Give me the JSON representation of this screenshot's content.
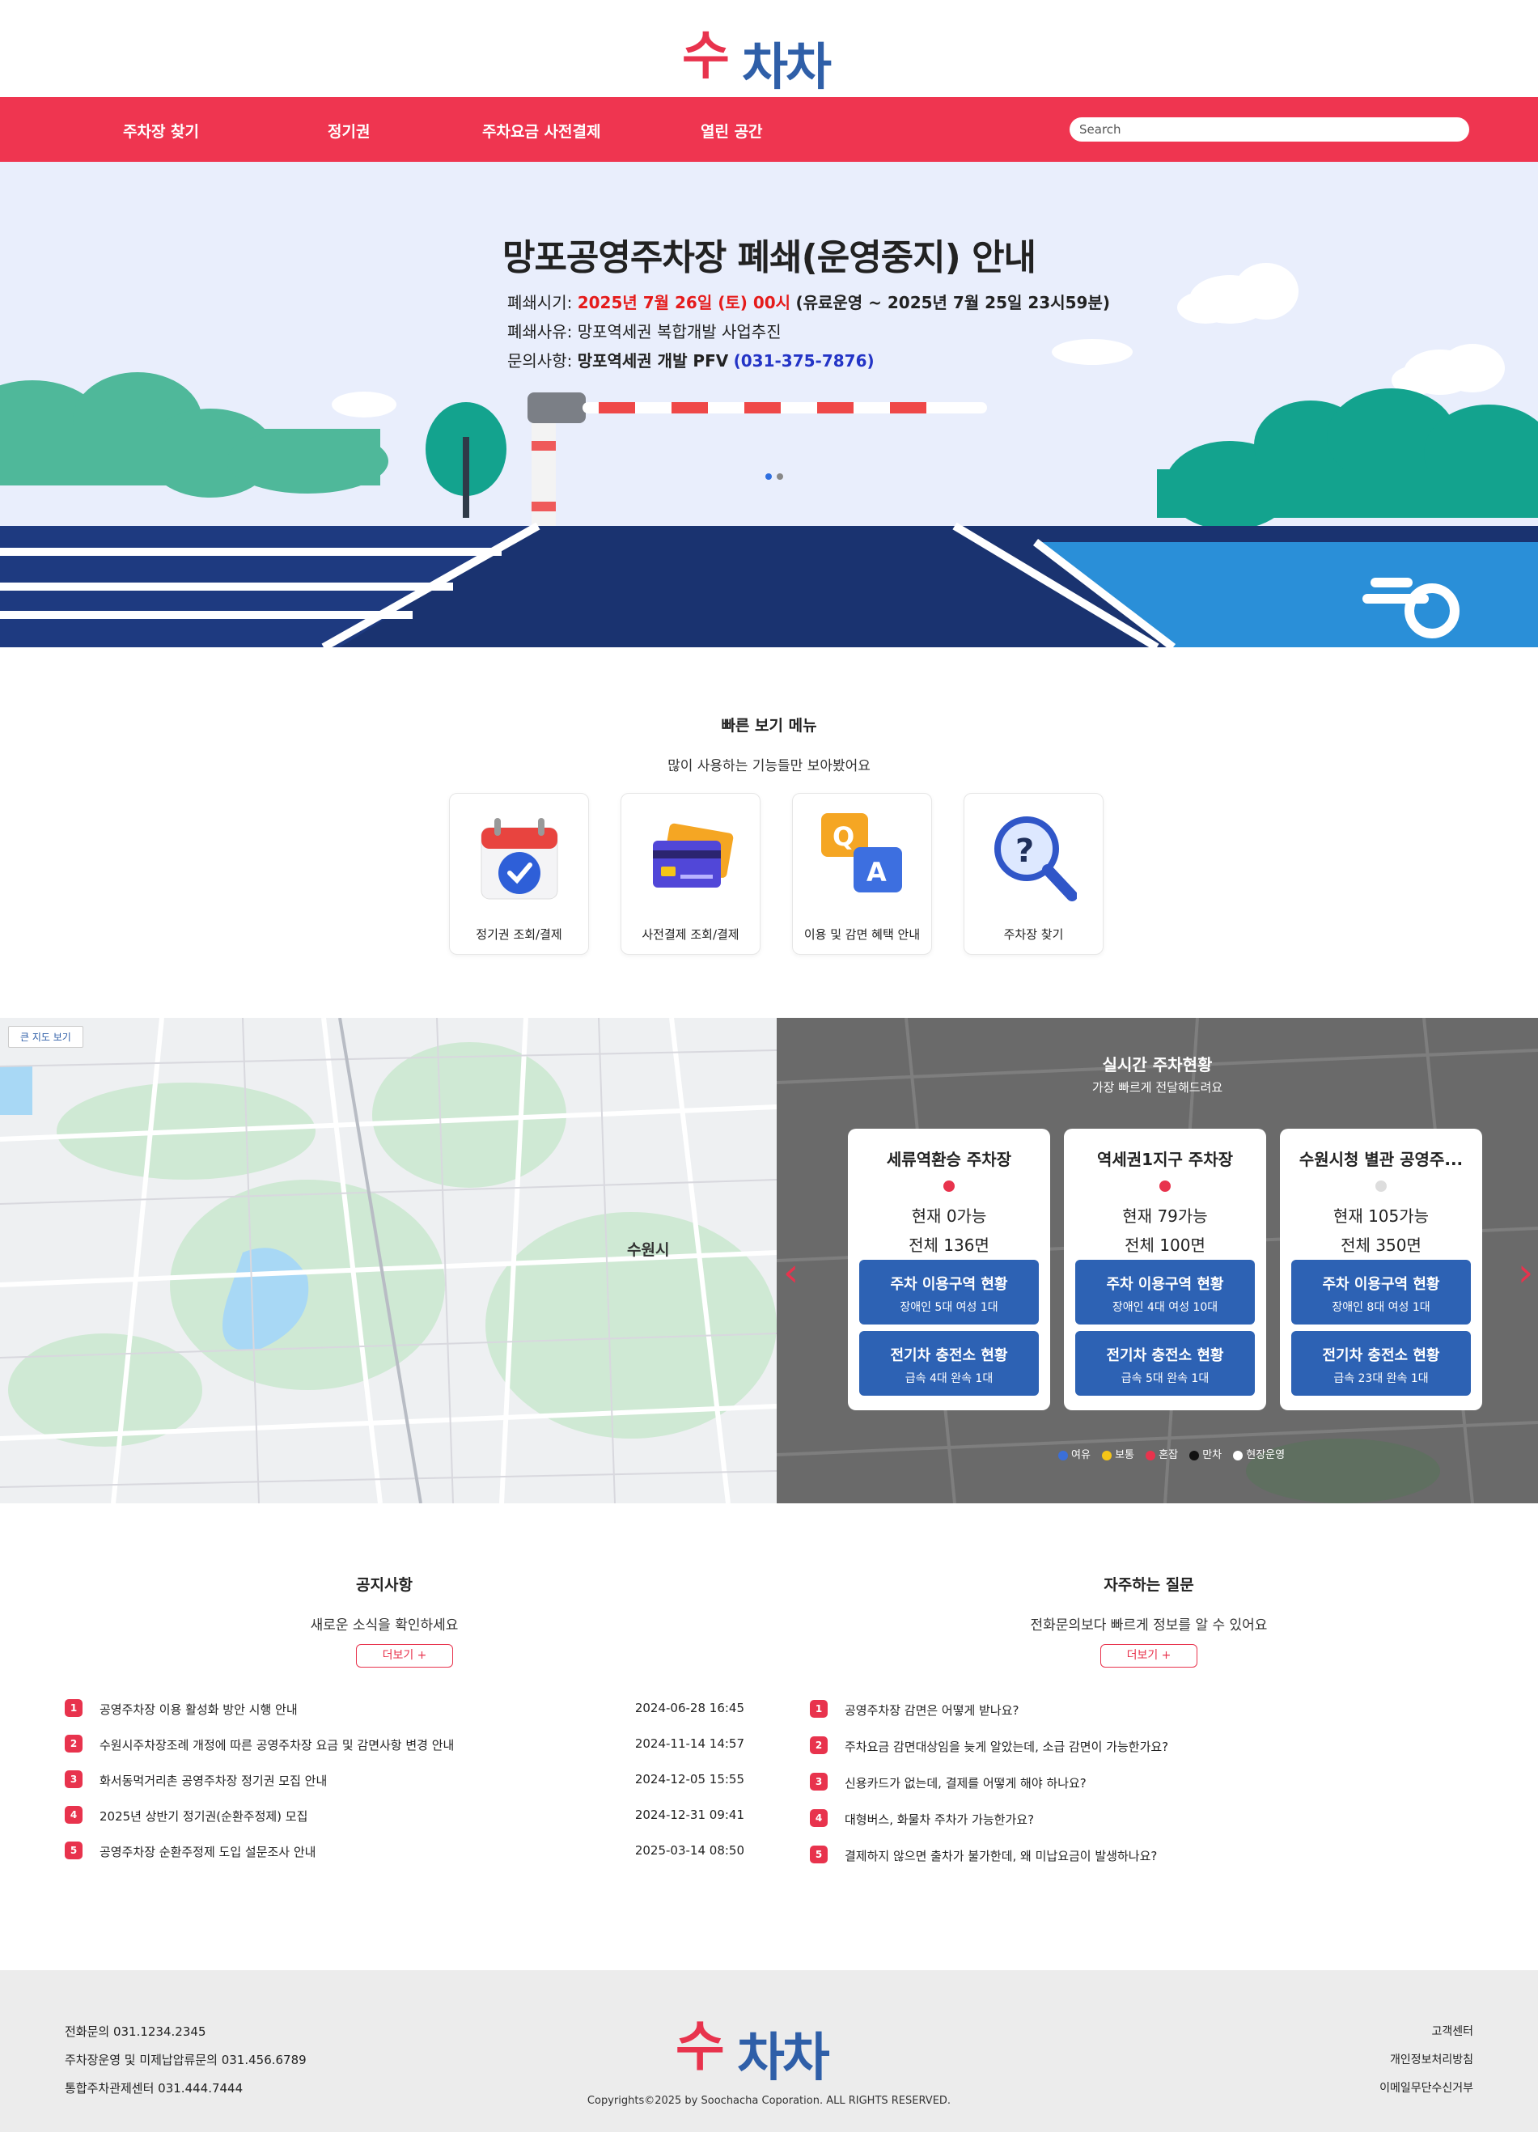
{
  "header": {
    "logo_su": "수",
    "logo_chacha": "차차",
    "nav": [
      "주차장 찾기",
      "정기권",
      "주차요금 사전결제",
      "열린 공간"
    ],
    "search_placeholder": "Search"
  },
  "hero": {
    "title": "망포공영주차장 폐쇄(운영중지) 안내",
    "line1_label": "폐쇄시기:",
    "line1_red": "2025년 7월 26일 (토) 00시",
    "line1_rest": "(유료운영 ~ 2025년 7월 25일 23시59분)",
    "line2": "폐쇄사유: 망포역세권 복합개발 사업추진",
    "line3_label": "문의사항:",
    "line3_bold": "망포역세권 개발 PFV",
    "line3_phone": "(031-375-7876)",
    "slide_count": 2,
    "active_slide": 0
  },
  "quick_menu": {
    "title": "빠른 보기 메뉴",
    "subtitle": "많이 사용하는 기능들만 보아봤어요",
    "items": [
      {
        "label": "정기권 조회/결제",
        "icon": "calendar-check-icon"
      },
      {
        "label": "사전결제 조회/결제",
        "icon": "credit-card-icon"
      },
      {
        "label": "이용 및 감면 혜택 안내",
        "icon": "qa-bubble-icon"
      },
      {
        "label": "주차장 찾기",
        "icon": "magnifier-question-icon"
      }
    ]
  },
  "map": {
    "big_map_button": "큰 지도 보기",
    "city_label": "수원시"
  },
  "realtime": {
    "title": "실시간 주차현황",
    "subtitle": "가장 빠르게 전달해드려요",
    "cards": [
      {
        "name": "세류역환승 주차장",
        "status": "red",
        "current": "현재 0가능",
        "total": "전체 136면",
        "zone_title": "주차 이용구역 현황",
        "zone_detail": "장애인 5대    여성 1대",
        "ev_title": "전기차 충전소 현황",
        "ev_detail": "급속 4대      완속 1대"
      },
      {
        "name": "역세권1지구 주차장",
        "status": "red",
        "current": "현재 79가능",
        "total": "전체 100면",
        "zone_title": "주차 이용구역 현황",
        "zone_detail": "장애인 4대 여성 10대",
        "ev_title": "전기차 충전소 현황",
        "ev_detail": "급속 5대      완속 1대"
      },
      {
        "name": "수원시청 별관 공영주...",
        "status": "gray",
        "current": "현재 105가능",
        "total": "전체 350면",
        "zone_title": "주차 이용구역 현황",
        "zone_detail": "장애인 8대    여성 1대",
        "ev_title": "전기차 충전소 현황",
        "ev_detail": "급속 23대     완속 1대"
      }
    ],
    "legend": [
      {
        "label": "여유",
        "color": "#3b6fd8"
      },
      {
        "label": "보통",
        "color": "#f5c518"
      },
      {
        "label": "혼잡",
        "color": "#e8334d"
      },
      {
        "label": "만차",
        "color": "#111111"
      },
      {
        "label": "현장운영",
        "color": "#ffffff"
      }
    ]
  },
  "notice": {
    "title": "공지사항",
    "subtitle": "새로운 소식을 확인하세요",
    "more": "더보기 +",
    "items": [
      {
        "num": "1",
        "text": "공영주차장 이용 활성화 방안 시행 안내",
        "date": "2024-06-28 16:45"
      },
      {
        "num": "2",
        "text": "수원시주차장조례 개정에 따른 공영주차장 요금 및 감면사항 변경 안내",
        "date": "2024-11-14 14:57"
      },
      {
        "num": "3",
        "text": "화서동먹거리촌 공영주차장 정기권 모집 안내",
        "date": "2024-12-05 15:55"
      },
      {
        "num": "4",
        "text": "2025년 상반기 정기권(순환주정제) 모집",
        "date": "2024-12-31 09:41"
      },
      {
        "num": "5",
        "text": "공영주차장 순환주정제 도입 설문조사 안내",
        "date": "2025-03-14 08:50"
      }
    ]
  },
  "faq": {
    "title": "자주하는 질문",
    "subtitle": "전화문의보다 빠르게 정보를 알 수 있어요",
    "more": "더보기 +",
    "items": [
      {
        "num": "1",
        "text": "공영주차장 감면은 어떻게 받나요?"
      },
      {
        "num": "2",
        "text": "주차요금 감면대상임을 늦게 알았는데, 소급 감면이 가능한가요?"
      },
      {
        "num": "3",
        "text": "신용카드가 없는데, 결제를 어떻게 해야 하나요?"
      },
      {
        "num": "4",
        "text": "대형버스, 화물차 주차가 가능한가요?"
      },
      {
        "num": "5",
        "text": "결제하지 않으면 출차가 불가한데, 왜 미납요금이 발생하나요?"
      }
    ]
  },
  "footer": {
    "phone1": "전화문의 031.1234.2345",
    "phone2": "주차장운영 및 미제납압류문의 031.456.6789",
    "phone3": "통합주차관제센터 031.444.7444",
    "links": [
      "고객센터",
      "개인정보처리방침",
      "이메일무단수신거부"
    ],
    "copyright": "Copyrights©2025 by Soochacha Coporation. ALL RIGHTS RESERVED.",
    "logo_su": "수",
    "logo_chacha": "차차"
  }
}
